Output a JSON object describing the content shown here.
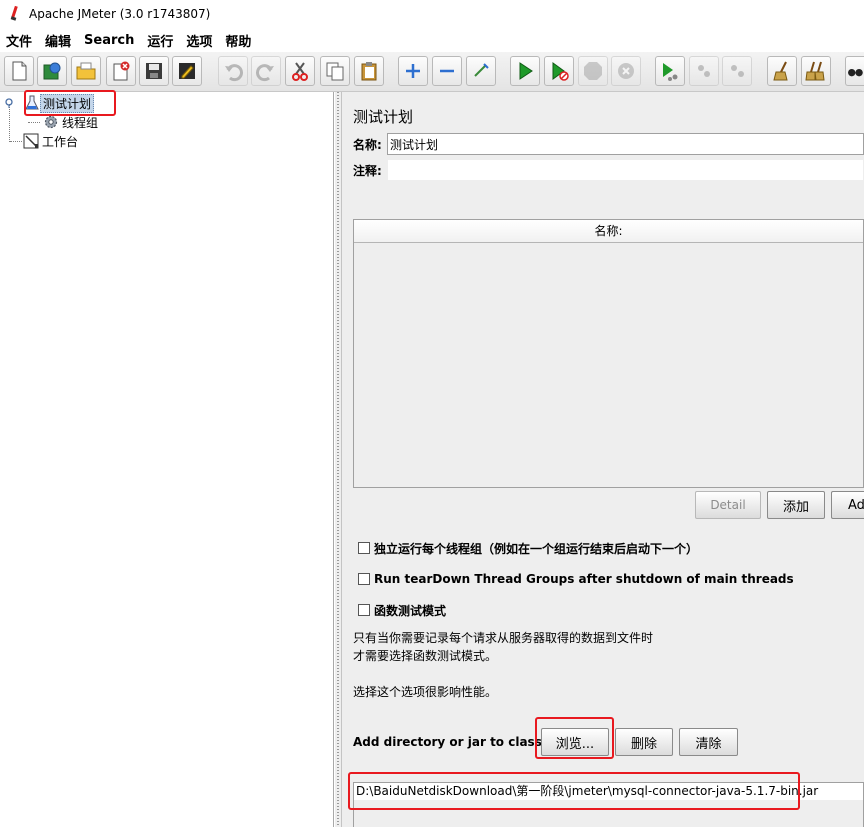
{
  "window": {
    "title": "Apache JMeter (3.0 r1743807)"
  },
  "menu": [
    "文件",
    "编辑",
    "Search",
    "运行",
    "选项",
    "帮助"
  ],
  "tree": {
    "test_plan": "测试计划",
    "thread_group": "线程组",
    "workbench": "工作台"
  },
  "panel": {
    "title": "测试计划",
    "name_label": "名称:",
    "name_value": "测试计划",
    "comment_label": "注释:",
    "comment_value": ""
  },
  "variables_table": {
    "column_header": "名称:"
  },
  "table_buttons": {
    "detail": "Detail",
    "add": "添加",
    "add_from_clipboard": "Ad"
  },
  "options": {
    "run_independently": "独立运行每个线程组（例如在一个组运行结束后启动下一个）",
    "teardown": "Run tearDown Thread Groups after shutdown of main threads",
    "functional_mode": "函数测试模式"
  },
  "notes": {
    "line1": "只有当你需要记录每个请求从服务器取得的数据到文件时",
    "line2": "才需要选择函数测试模式。",
    "line3": "选择这个选项很影响性能。"
  },
  "classpath": {
    "label": "Add directory or jar to classpath",
    "browse": "浏览...",
    "delete": "删除",
    "clear": "清除",
    "entries": [
      "D:\\BaiduNetdiskDownload\\第一阶段\\jmeter\\mysql-connector-java-5.1.7-bin.jar"
    ]
  },
  "colors": {
    "highlight": "#e8191f",
    "selection": "#c4d6ea",
    "panel_bg": "#eeeeee"
  }
}
